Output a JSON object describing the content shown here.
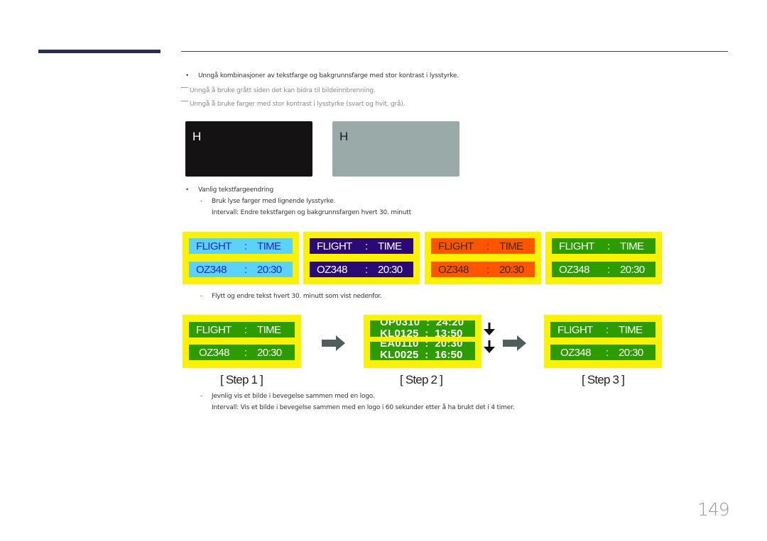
{
  "page": {
    "number": "149"
  },
  "intro": {
    "bullet": "Unngå kombinasjoner av tekstfarge og bakgrunnsfarge med stor kontrast i lysstyrke.",
    "notes": [
      "Unngå å bruke grått siden det kan bidra til bildeinnbrenning.",
      "Unngå å bruke farger med stor kontrast i lysstyrke (svart og hvit, grå)."
    ]
  },
  "samples": [
    {
      "letter": "H",
      "bg": "#141212",
      "fg": "#ffffff"
    },
    {
      "letter": "H",
      "bg": "#99aaa9",
      "fg": "#1d1d1d"
    }
  ],
  "section1": {
    "bullet": "Vanlig tekstfargeendring",
    "sub": "Bruk lyse farger med lignende lysstyrke.",
    "interval": "Intervall: Endre tekstfargen og bakgrunnsfargen hvert 30. minutt"
  },
  "boards_header": {
    "col1": "FLIGHT",
    "sep": ":",
    "col2": "TIME",
    "flight": "OZ348",
    "time": "20:30"
  },
  "color_boards": [
    {
      "bg": "#5bd2f7",
      "fg": "#2426d0"
    },
    {
      "bg": "#2b0a78",
      "fg": "#ffffff"
    },
    {
      "bg": "#ff5500",
      "fg": "#3a2a20"
    },
    {
      "bg": "#2d9c00",
      "fg": "#ffffff"
    }
  ],
  "section2": {
    "sub": "Flytt og endre tekst hvert 30. minutt som vist nedenfor."
  },
  "steps": [
    {
      "label": "[ Step 1 ]"
    },
    {
      "label": "[ Step 2 ]"
    },
    {
      "label": "[ Step 3 ]"
    }
  ],
  "step_board": {
    "bg": "#2d9c00",
    "fg": "#ffffff",
    "frame": "#fbf200"
  },
  "step2_scroll": {
    "block1": [
      "OP0310  :  24:20",
      "KL0125  :  13:50"
    ],
    "block2": [
      "EA0110  :  20:30",
      "KL0025  :  16:50"
    ]
  },
  "section3": {
    "sub": "Jevnlig vis et bilde i bevegelse sammen med en logo.",
    "interval": "Intervall: Vis et bilde i bevegelse sammen med en logo i 60 sekunder etter å ha brukt det i 4 timer."
  },
  "icons": {
    "arrow_right": "arrow-right-icon",
    "arrow_down": "arrow-down-icon"
  }
}
